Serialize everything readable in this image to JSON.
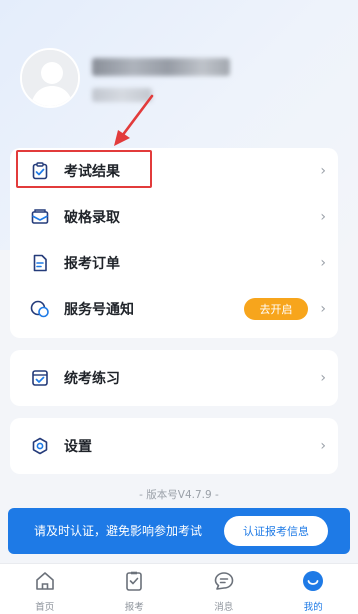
{
  "profile": {
    "name_blurred": true
  },
  "menu_group_1": [
    {
      "label": "考试结果",
      "icon": "clipboard-check-icon"
    },
    {
      "label": "破格录取",
      "icon": "envelope-icon"
    },
    {
      "label": "报考订单",
      "icon": "document-icon"
    },
    {
      "label": "服务号通知",
      "icon": "chat-bubbles-icon",
      "action_label": "去开启"
    }
  ],
  "menu_group_2": [
    {
      "label": "统考练习",
      "icon": "checkbox-icon"
    }
  ],
  "menu_group_3": [
    {
      "label": "设置",
      "icon": "settings-icon"
    }
  ],
  "chevron": "›",
  "version": "- 版本号V4.7.9 -",
  "banner": {
    "text": "请及时认证，避免影响参加考试",
    "button": "认证报考信息"
  },
  "tabs": [
    {
      "label": "首页",
      "icon": "home-icon",
      "active": false
    },
    {
      "label": "报考",
      "icon": "exam-icon",
      "active": false
    },
    {
      "label": "消息",
      "icon": "message-icon",
      "active": false
    },
    {
      "label": "我的",
      "icon": "profile-icon",
      "active": true
    }
  ],
  "colors": {
    "accent": "#1e7ae6",
    "highlight_box": "#e23b3b",
    "pill": "#f7a51c"
  }
}
